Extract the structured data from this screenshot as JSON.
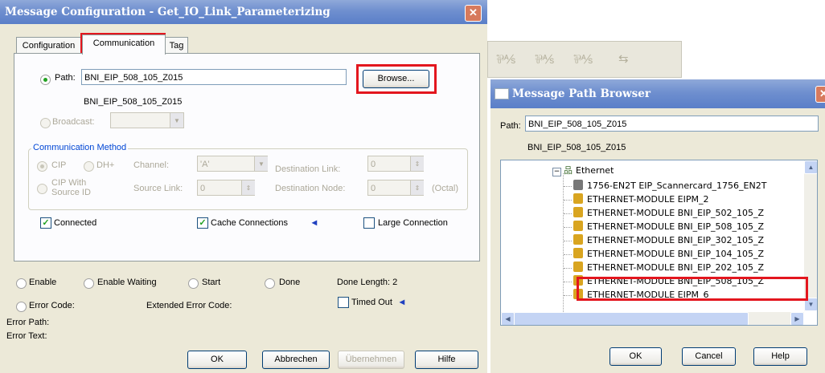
{
  "dialog": {
    "title": "Message Configuration - Get_IO_Link_Parameterizing",
    "close_glyph": "✕",
    "tabs": [
      {
        "label": "Configuration"
      },
      {
        "label": "Communication"
      },
      {
        "label": "Tag"
      }
    ],
    "path_label": "Path:",
    "path_value": "BNI_EIP_508_105_Z015",
    "path_resolved": "BNI_EIP_508_105_Z015",
    "browse_label": "Browse...",
    "broadcast_label": "Broadcast:",
    "comm_method": {
      "group_label": "Communication Method",
      "cip_label": "CIP",
      "dhplus_label": "DH+",
      "channel_label": "Channel:",
      "channel_value": "'A'",
      "dest_link_label": "Destination Link:",
      "dest_link_value": "0",
      "cip_source_label_1": "CIP With",
      "cip_source_label_2": "Source ID",
      "source_link_label": "Source Link:",
      "source_link_value": "0",
      "dest_node_label": "Destination Node:",
      "dest_node_value": "0",
      "octal_label": "(Octal)"
    },
    "connected_label": "Connected",
    "connected_checked": true,
    "cache_label": "Cache Connections",
    "cache_checked": true,
    "large_label": "Large Connection",
    "large_checked": false,
    "status": {
      "enable": "Enable",
      "enable_waiting": "Enable Waiting",
      "start": "Start",
      "done": "Done",
      "done_length": "Done Length: 2",
      "error_code": "Error Code:",
      "extended_error_code": "Extended Error Code:",
      "timed_out": "Timed Out",
      "error_path": "Error Path:",
      "error_text": "Error Text:"
    },
    "buttons": {
      "ok": "OK",
      "cancel": "Abbrechen",
      "apply": "Übernehmen",
      "help": "Hilfe"
    }
  },
  "path_browser": {
    "title": "Message Path Browser",
    "path_label": "Path:",
    "path_value": "BNI_EIP_508_105_Z015",
    "path_resolved": "BNI_EIP_508_105_Z015",
    "tree": {
      "root": "Ethernet",
      "items": [
        "1756-EN2T EIP_Scannercard_1756_EN2T",
        "ETHERNET-MODULE EIPM_2",
        "ETHERNET-MODULE BNI_EIP_502_105_Z",
        "ETHERNET-MODULE BNI_EIP_508_105_Z",
        "ETHERNET-MODULE BNI_EIP_302_105_Z",
        "ETHERNET-MODULE BNI_EIP_104_105_Z",
        "ETHERNET-MODULE BNI_EIP_202_105_Z",
        "ETHERNET-MODULE BNI_EIP_508_105_Z",
        "ETHERNET-MODULE EIPM_6"
      ],
      "selected_index": 7
    },
    "buttons": {
      "ok": "OK",
      "cancel": "Cancel",
      "help": "Help"
    }
  },
  "colors": {
    "highlight": "#e3161e",
    "titlebar": "#6f8fcf",
    "dialog_bg": "#ece9d8"
  }
}
